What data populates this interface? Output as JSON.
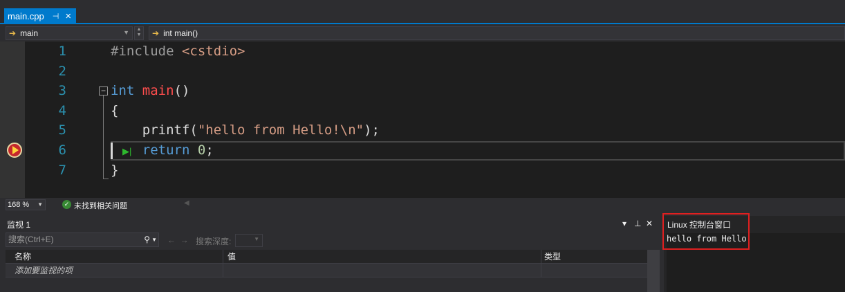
{
  "tab": {
    "filename": "main.cpp",
    "pin_glyph": "⊣",
    "close_glyph": "×"
  },
  "nav": {
    "scope": "main",
    "member": "int main()"
  },
  "editor": {
    "line_numbers": [
      "1",
      "2",
      "3",
      "4",
      "5",
      "6",
      "7"
    ],
    "lines": [
      {
        "a": "#include ",
        "b": "<cstdio>"
      },
      {},
      {
        "kw": "int",
        "fn": "main",
        "rest": "()"
      },
      {
        "rest": "{"
      },
      {
        "pre": "    ",
        "fn": "printf",
        "p1": "(",
        "str": "\"hello from Hello!\\n\"",
        "p2": ");"
      },
      {
        "pre": "    ",
        "kw": "return",
        "num": "0",
        "p2": ";"
      },
      {
        "rest": "}"
      }
    ],
    "breakpoint_line": 6,
    "fold_glyph": "−"
  },
  "status": {
    "zoom": "168 %",
    "issues": "未找到相关问题"
  },
  "watch": {
    "title": "监视 1",
    "search_placeholder": "搜索(Ctrl+E)",
    "depth_label": "搜索深度:",
    "columns": [
      "名称",
      "值",
      "类型"
    ],
    "add_hint": "添加要监视的项"
  },
  "linux_console": {
    "title": "Linux 控制台窗口",
    "output": "hello from Hello!"
  },
  "colors": {
    "accent": "#007acc",
    "highlight_box": "#e02020",
    "keyword": "#569cd6",
    "string": "#d69d85",
    "function": "#ff4d4d"
  }
}
